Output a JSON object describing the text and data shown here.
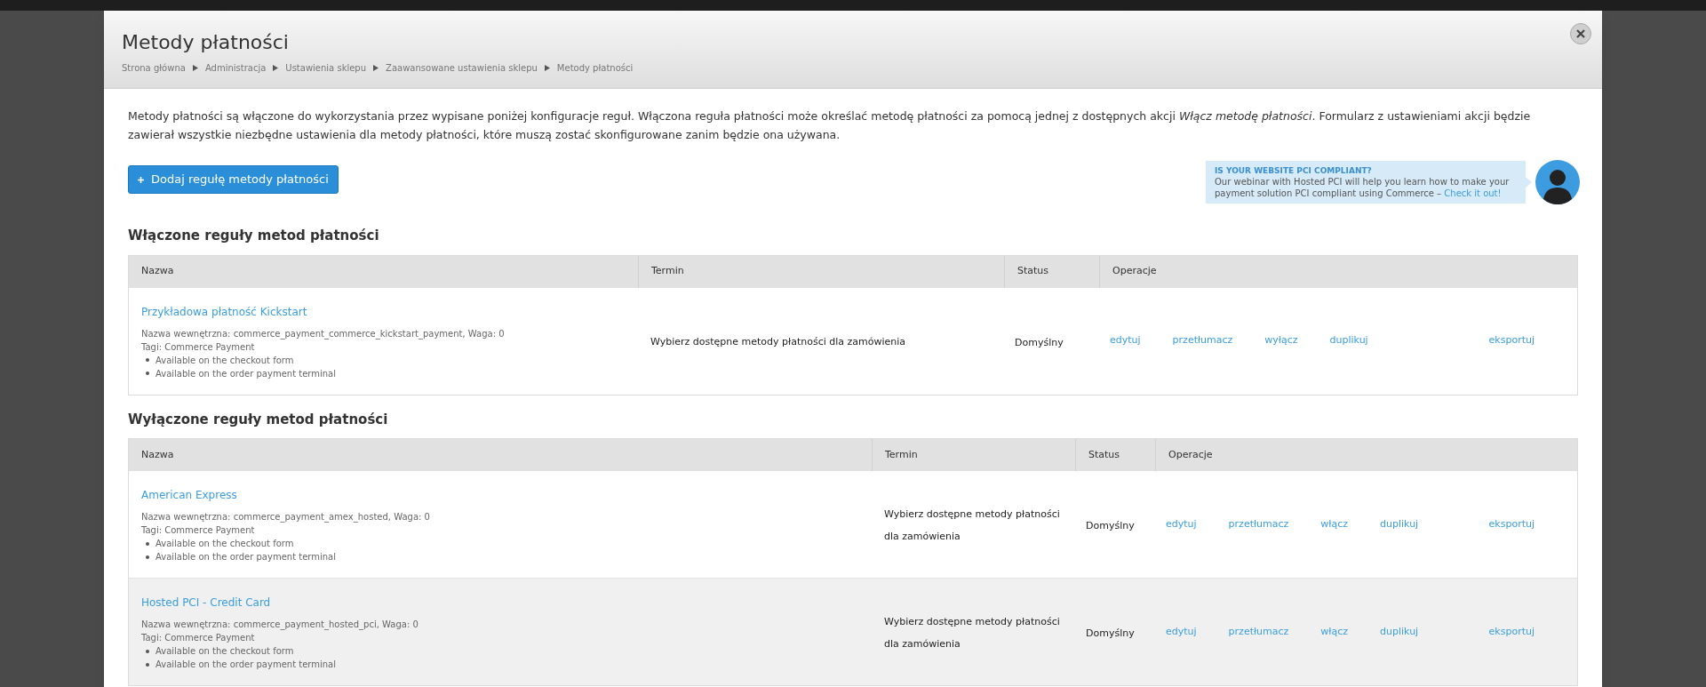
{
  "modal": {
    "title": "Metody płatności",
    "breadcrumbs": [
      "Strona główna",
      "Administracja",
      "Ustawienia sklepu",
      "Zaawansowane ustawienia sklepu",
      "Metody płatności"
    ]
  },
  "description": "Metody płatności są włączone do wykorzystania przez wypisane poniżej konfiguracje reguł. Włączona reguła płatności może określać metodę płatności za pomocą jednej z dostępnych akcji *Włącz metodę płatności*. Formularz z ustawieniami akcji będzie zawierał wszystkie niezbędne ustawienia dla metody płatności, które muszą zostać skonfigurowane zanim będzie ona używana.",
  "add_button": {
    "label": "Dodaj regułę metody płatności"
  },
  "promo": {
    "heading": "IS YOUR WEBSITE PCI COMPLIANT?",
    "text": "Our webinar  with Hosted PCI will help  you learn how to make your payment solution PCI compliant using Commerce –",
    "link": "Check it out!"
  },
  "sections": [
    {
      "title": "Włączone reguły metod płatności",
      "columns": [
        "Nazwa",
        "Termin",
        "Status",
        "Operacje"
      ],
      "rows": [
        {
          "name": "Przykładowa płatność Kickstart",
          "machine_name": "Nazwa wewnętrzna: commerce_payment_commerce_kickstart_payment, Waga: 0",
          "tags": "Tagi: Commerce Payment",
          "bullets": [
            "Available on the checkout form",
            "Available on the order payment terminal"
          ],
          "term": "Wybierz dostępne metody płatności dla zamówienia",
          "status": "Domyślny",
          "operations": [
            "edytuj",
            "przetłumacz",
            "wyłącz",
            "duplikuj",
            "eksportuj"
          ]
        }
      ]
    },
    {
      "title": "Wyłączone reguły metod płatności",
      "columns": [
        "Nazwa",
        "Termin",
        "Status",
        "Operacje"
      ],
      "rows": [
        {
          "name": "American Express",
          "machine_name": "Nazwa wewnętrzna: commerce_payment_amex_hosted, Waga: 0",
          "tags": "Tagi: Commerce Payment",
          "bullets": [
            "Available on the checkout form",
            "Available on the order payment terminal"
          ],
          "term": "Wybierz dostępne metody płatności dla zamówienia",
          "status": "Domyślny",
          "operations": [
            "edytuj",
            "przetłumacz",
            "włącz",
            "duplikuj",
            "eksportuj"
          ]
        },
        {
          "name": "Hosted PCI - Credit Card",
          "machine_name": "Nazwa wewnętrzna: commerce_payment_hosted_pci, Waga: 0",
          "tags": "Tagi: Commerce Payment",
          "bullets": [
            "Available on the checkout form",
            "Available on the order payment terminal"
          ],
          "term": "Wybierz dostępne metody płatności dla zamówienia",
          "status": "Domyślny",
          "operations": [
            "edytuj",
            "przetłumacz",
            "włącz",
            "duplikuj",
            "eksportuj"
          ]
        }
      ]
    }
  ]
}
